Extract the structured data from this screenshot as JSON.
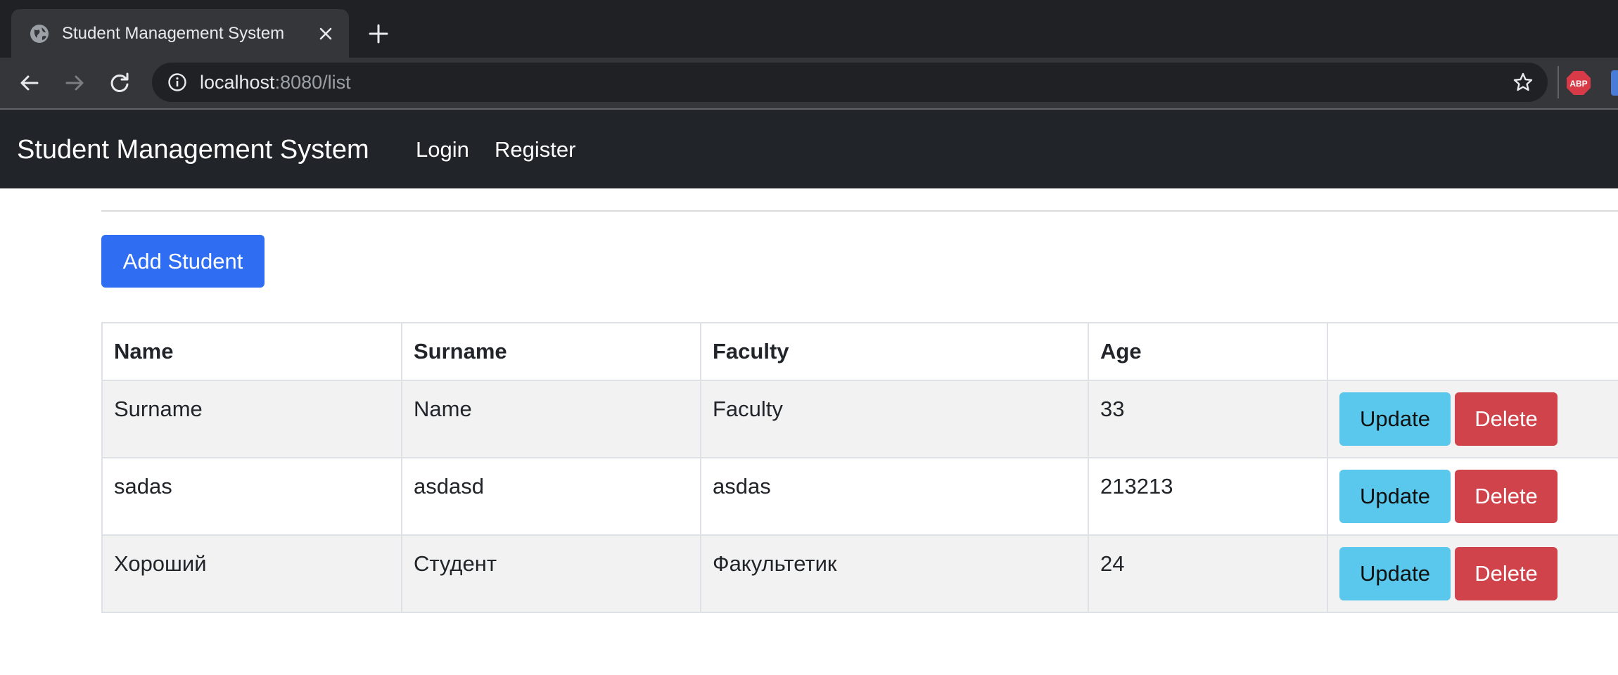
{
  "browser": {
    "tab_title": "Student Management System",
    "url_host": "localhost",
    "url_rest": ":8080/list",
    "icons": [
      "globe-icon",
      "close-icon",
      "plus-icon",
      "arrow-left-icon",
      "arrow-right-icon",
      "reload-icon",
      "info-icon",
      "star-icon",
      "abp-icon"
    ],
    "abp_label": "ABP"
  },
  "navbar": {
    "brand": "Student Management System",
    "links": [
      {
        "label": "Login"
      },
      {
        "label": "Register"
      }
    ]
  },
  "main": {
    "add_button": "Add Student",
    "table": {
      "headers": [
        "Name",
        "Surname",
        "Faculty",
        "Age",
        ""
      ],
      "rows": [
        {
          "name": "Surname",
          "surname": "Name",
          "faculty": "Faculty",
          "age": "33"
        },
        {
          "name": "sadas",
          "surname": "asdasd",
          "faculty": "asdas",
          "age": "213213"
        },
        {
          "name": "Хороший",
          "surname": "Студент",
          "faculty": "Факультетик",
          "age": "24"
        }
      ],
      "update_label": "Update",
      "delete_label": "Delete"
    }
  },
  "colors": {
    "navbar": "#212529",
    "primary": "#2f6ef2",
    "info": "#5ac8ec",
    "danger": "#d1434b"
  }
}
